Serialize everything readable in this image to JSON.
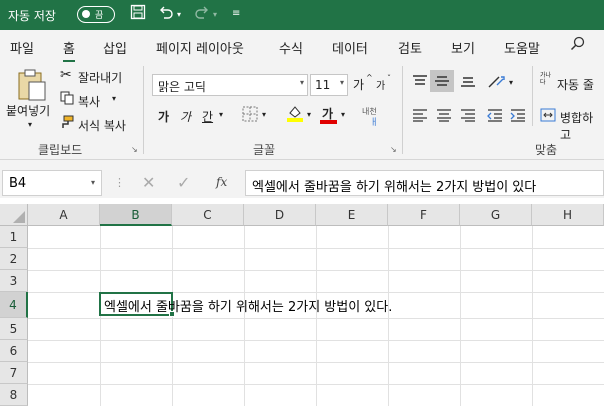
{
  "titlebar": {
    "autosave_label": "자동 저장",
    "toggle_state": "끔"
  },
  "menu": {
    "tabs": [
      "파일",
      "홈",
      "삽입",
      "페이지 레이아웃",
      "수식",
      "데이터",
      "검토",
      "보기",
      "도움말"
    ],
    "active": "홈"
  },
  "ribbon": {
    "clipboard": {
      "paste": "붙여넣기",
      "cut": "잘라내기",
      "copy": "복사",
      "format_painter": "서식 복사",
      "group": "클립보드"
    },
    "font": {
      "name": "맑은 고딕",
      "size": "11",
      "grow": "가",
      "shrink": "가",
      "bold": "가",
      "italic": "가",
      "underline": "간",
      "font_color_glyph": "가",
      "phonetic": "내천",
      "group": "글꼴"
    },
    "alignment": {
      "wrap_text": "자동 줄",
      "merge": "병합하고",
      "group": "맞춤",
      "wrap_icon_text": "가나다"
    }
  },
  "formula_bar": {
    "name_box": "B4",
    "fx": "fx",
    "content": "엑셀에서 줄바꿈을 하기 위해서는 2가지 방법이 있다"
  },
  "sheet": {
    "columns": [
      "A",
      "B",
      "C",
      "D",
      "E",
      "F",
      "G",
      "H"
    ],
    "rows": [
      "1",
      "2",
      "3",
      "4",
      "5",
      "6",
      "7",
      "8"
    ],
    "selected_col": "B",
    "selected_row": "4",
    "cell_b4": "엑셀에서 줄바꿈을 하기 위해서는 2가지 방법이 있다."
  },
  "colors": {
    "accent": "#217346"
  }
}
